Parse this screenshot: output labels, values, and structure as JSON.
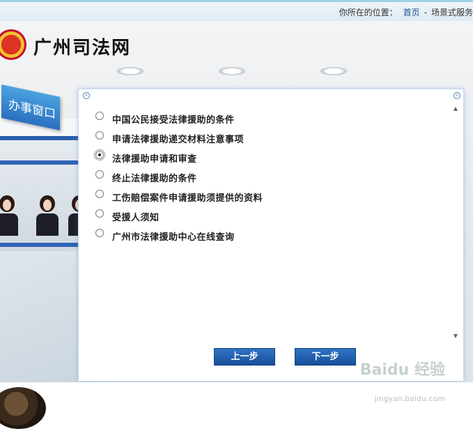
{
  "breadcrumb": {
    "prefix": "你所在的位置：",
    "home": "首页",
    "separator": "-",
    "current": "场景式服务"
  },
  "site": {
    "title": "广州司法网"
  },
  "scene": {
    "sign_label": "办事窗口"
  },
  "options": [
    {
      "label": "中国公民接受法律援助的条件",
      "checked": false
    },
    {
      "label": "申请法律援助递交材料注意事项",
      "checked": false
    },
    {
      "label": "法律援助申请和审查",
      "checked": true
    },
    {
      "label": "终止法律援助的条件",
      "checked": false
    },
    {
      "label": "工伤赔偿案件申请援助须提供的资料",
      "checked": false
    },
    {
      "label": "受援人须知",
      "checked": false
    },
    {
      "label": "广州市法律援助中心在线查询",
      "checked": false
    }
  ],
  "buttons": {
    "prev": "上一步",
    "next": "下一步"
  },
  "watermark": {
    "text": "Baidu 经验",
    "url": "jingyan.baidu.com"
  }
}
